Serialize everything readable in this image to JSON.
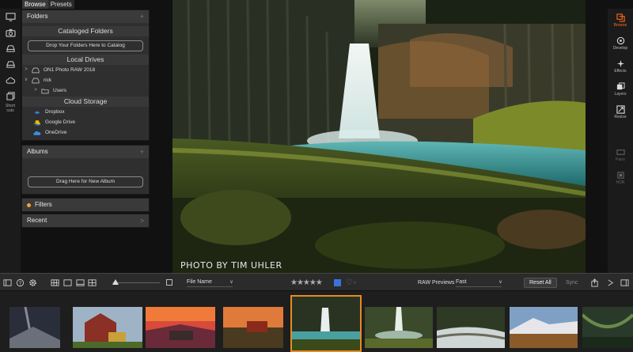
{
  "top_tabs": [
    "Browse",
    "Presets"
  ],
  "left_strip": {
    "icons": [
      "monitor-icon",
      "camera-icon",
      "drive-icon",
      "drive-icon",
      "cloud-icon",
      "shortcuts-icon"
    ],
    "shortcuts_label_1": "Short",
    "shortcuts_label_2": "cuts"
  },
  "folders_panel": {
    "title": "Folders",
    "cataloged_title": "Cataloged Folders",
    "drop_button": "Drop Your Folders Here to Catalog",
    "local_drives_title": "Local Drives",
    "drives": [
      {
        "label": "ON1 Photo RAW 2018",
        "indent": 0
      },
      {
        "label": "rick",
        "indent": 0
      },
      {
        "label": "Users",
        "indent": 1
      }
    ],
    "cloud_title": "Cloud Storage",
    "cloud": [
      {
        "label": "Dropbox",
        "color": "#2d7ff0"
      },
      {
        "label": "Google Drive",
        "color": "#f4b400"
      },
      {
        "label": "OneDrive",
        "color": "#3a8ee6"
      }
    ]
  },
  "albums_panel": {
    "title": "Albums",
    "drag_button": "Drag Here for New Album"
  },
  "filters_panel": {
    "title": "Filters",
    "dot_color": "#f2a33a"
  },
  "recent_panel": {
    "title": "Recent"
  },
  "photo": {
    "credit": "PHOTO BY TIM UHLER"
  },
  "right_strip": {
    "items": [
      {
        "label": "Browse",
        "icon": "browse-icon",
        "active": true
      },
      {
        "label": "Develop",
        "icon": "develop-icon",
        "active": false
      },
      {
        "label": "Effects",
        "icon": "effects-icon",
        "active": false
      },
      {
        "label": "Layers",
        "icon": "layers-icon",
        "active": false
      },
      {
        "label": "Resize",
        "icon": "resize-icon",
        "active": false
      },
      {
        "label": "Pano",
        "icon": "pano-icon",
        "active": false
      },
      {
        "label": "HDR",
        "icon": "hdr-icon",
        "active": false
      }
    ],
    "accent": "#ff6a1a"
  },
  "toolbar": {
    "sort_label": "File Name",
    "stars": "★★★★★",
    "raw_previews_label": "RAW Previews",
    "raw_previews_value": "Fast",
    "reset_label": "Reset All",
    "sync_label": "Sync"
  }
}
